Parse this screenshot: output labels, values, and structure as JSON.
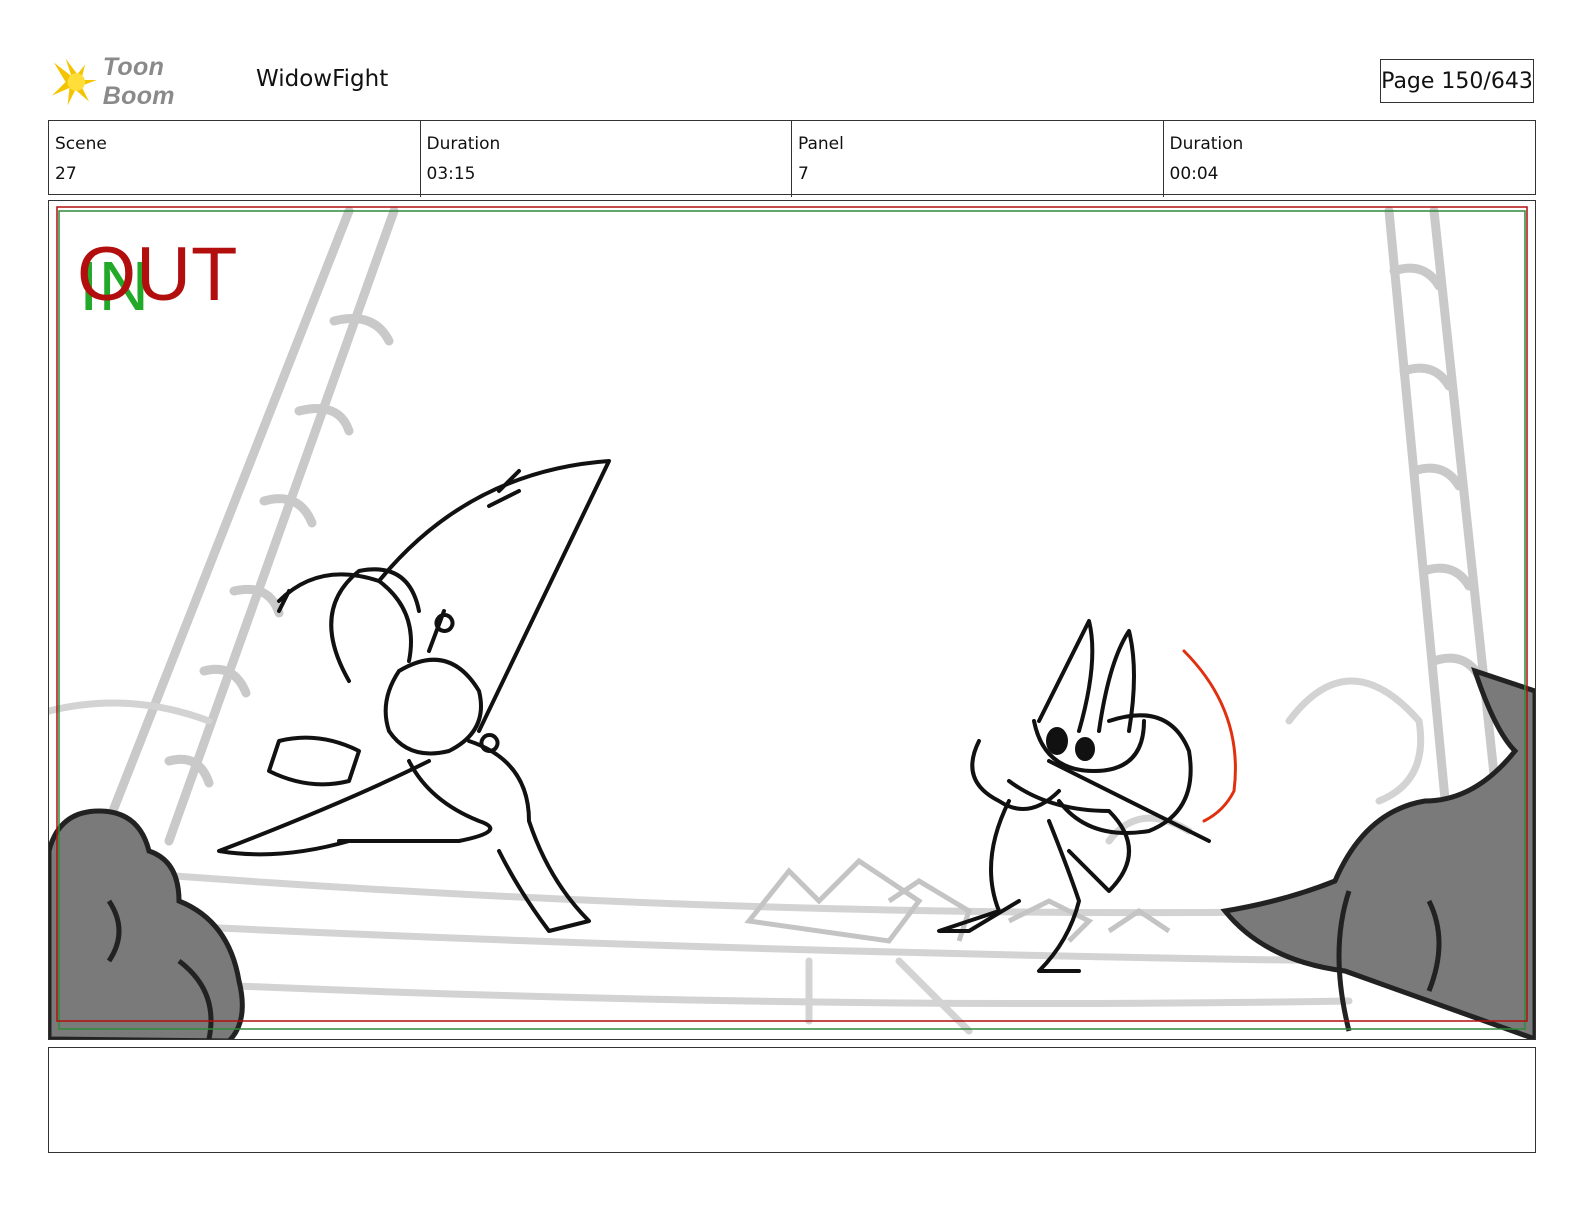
{
  "header": {
    "logo_text": "Toon Boom",
    "logo_icon": "starburst-icon",
    "project_title": "WidowFight",
    "page_label": "Page 150/643"
  },
  "info": {
    "scene_label": "Scene",
    "scene_value": "27",
    "scene_duration_label": "Duration",
    "scene_duration_value": "03:15",
    "panel_label": "Panel",
    "panel_value": "7",
    "panel_duration_label": "Duration",
    "panel_duration_value": "00:04"
  },
  "panel": {
    "in_marker": "IN",
    "out_marker": "OUT",
    "safe_frame_color": "#2e8b3a",
    "camera_frame_color": "#b20e0e"
  },
  "caption": {
    "text": ""
  }
}
